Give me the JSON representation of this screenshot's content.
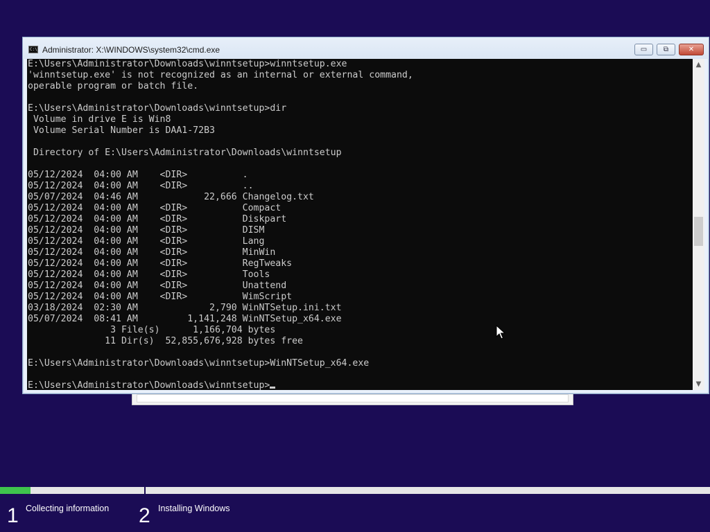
{
  "window": {
    "title": "Administrator: X:\\WINDOWS\\system32\\cmd.exe",
    "icon": "cmd-icon",
    "icon_glyph": "C:\\",
    "minimize_label": "▭",
    "maximize_label": "⧉",
    "close_label": "✕"
  },
  "console": {
    "lines": [
      "E:\\Users\\Administrator\\Downloads\\winntsetup>winntsetup.exe",
      "'winntsetup.exe' is not recognized as an internal or external command,",
      "operable program or batch file.",
      "",
      "E:\\Users\\Administrator\\Downloads\\winntsetup>dir",
      " Volume in drive E is Win8",
      " Volume Serial Number is DAA1-72B3",
      "",
      " Directory of E:\\Users\\Administrator\\Downloads\\winntsetup",
      "",
      "05/12/2024  04:00 AM    <DIR>          .",
      "05/12/2024  04:00 AM    <DIR>          ..",
      "05/07/2024  04:46 AM            22,666 Changelog.txt",
      "05/12/2024  04:00 AM    <DIR>          Compact",
      "05/12/2024  04:00 AM    <DIR>          Diskpart",
      "05/12/2024  04:00 AM    <DIR>          DISM",
      "05/12/2024  04:00 AM    <DIR>          Lang",
      "05/12/2024  04:00 AM    <DIR>          MinWin",
      "05/12/2024  04:00 AM    <DIR>          RegTweaks",
      "05/12/2024  04:00 AM    <DIR>          Tools",
      "05/12/2024  04:00 AM    <DIR>          Unattend",
      "05/12/2024  04:00 AM    <DIR>          WimScript",
      "03/18/2024  02:30 AM             2,790 WinNTSetup.ini.txt",
      "05/07/2024  08:41 AM         1,141,248 WinNTSetup_x64.exe",
      "               3 File(s)      1,166,704 bytes",
      "              11 Dir(s)  52,855,676,928 bytes free",
      "",
      "E:\\Users\\Administrator\\Downloads\\winntsetup>WinNTSetup_x64.exe",
      ""
    ],
    "prompt": "E:\\Users\\Administrator\\Downloads\\winntsetup>"
  },
  "scrollbar": {
    "up_label": "▲",
    "down_label": "▼"
  },
  "setup": {
    "progress_fraction": 0.043,
    "steps": [
      {
        "number": "1",
        "label": "Collecting information"
      },
      {
        "number": "2",
        "label": "Installing Windows"
      }
    ]
  },
  "colors": {
    "background": "#1b0c55",
    "console_bg": "#0c0c0c",
    "console_fg": "#cccccc",
    "progress": "#3fc44d"
  }
}
